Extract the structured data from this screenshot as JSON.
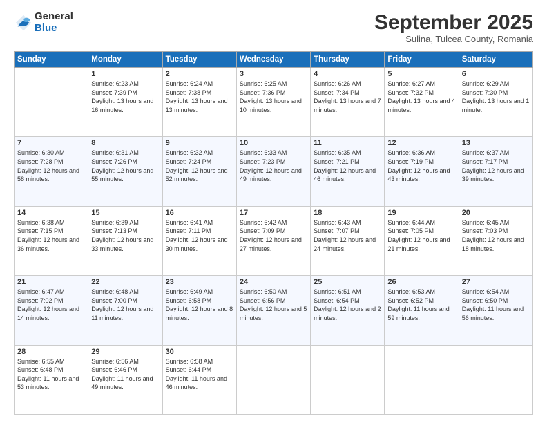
{
  "logo": {
    "general": "General",
    "blue": "Blue"
  },
  "header": {
    "month": "September 2025",
    "location": "Sulina, Tulcea County, Romania"
  },
  "weekdays": [
    "Sunday",
    "Monday",
    "Tuesday",
    "Wednesday",
    "Thursday",
    "Friday",
    "Saturday"
  ],
  "weeks": [
    [
      {
        "day": "",
        "sunrise": "",
        "sunset": "",
        "daylight": ""
      },
      {
        "day": "1",
        "sunrise": "Sunrise: 6:23 AM",
        "sunset": "Sunset: 7:39 PM",
        "daylight": "Daylight: 13 hours and 16 minutes."
      },
      {
        "day": "2",
        "sunrise": "Sunrise: 6:24 AM",
        "sunset": "Sunset: 7:38 PM",
        "daylight": "Daylight: 13 hours and 13 minutes."
      },
      {
        "day": "3",
        "sunrise": "Sunrise: 6:25 AM",
        "sunset": "Sunset: 7:36 PM",
        "daylight": "Daylight: 13 hours and 10 minutes."
      },
      {
        "day": "4",
        "sunrise": "Sunrise: 6:26 AM",
        "sunset": "Sunset: 7:34 PM",
        "daylight": "Daylight: 13 hours and 7 minutes."
      },
      {
        "day": "5",
        "sunrise": "Sunrise: 6:27 AM",
        "sunset": "Sunset: 7:32 PM",
        "daylight": "Daylight: 13 hours and 4 minutes."
      },
      {
        "day": "6",
        "sunrise": "Sunrise: 6:29 AM",
        "sunset": "Sunset: 7:30 PM",
        "daylight": "Daylight: 13 hours and 1 minute."
      }
    ],
    [
      {
        "day": "7",
        "sunrise": "Sunrise: 6:30 AM",
        "sunset": "Sunset: 7:28 PM",
        "daylight": "Daylight: 12 hours and 58 minutes."
      },
      {
        "day": "8",
        "sunrise": "Sunrise: 6:31 AM",
        "sunset": "Sunset: 7:26 PM",
        "daylight": "Daylight: 12 hours and 55 minutes."
      },
      {
        "day": "9",
        "sunrise": "Sunrise: 6:32 AM",
        "sunset": "Sunset: 7:24 PM",
        "daylight": "Daylight: 12 hours and 52 minutes."
      },
      {
        "day": "10",
        "sunrise": "Sunrise: 6:33 AM",
        "sunset": "Sunset: 7:23 PM",
        "daylight": "Daylight: 12 hours and 49 minutes."
      },
      {
        "day": "11",
        "sunrise": "Sunrise: 6:35 AM",
        "sunset": "Sunset: 7:21 PM",
        "daylight": "Daylight: 12 hours and 46 minutes."
      },
      {
        "day": "12",
        "sunrise": "Sunrise: 6:36 AM",
        "sunset": "Sunset: 7:19 PM",
        "daylight": "Daylight: 12 hours and 43 minutes."
      },
      {
        "day": "13",
        "sunrise": "Sunrise: 6:37 AM",
        "sunset": "Sunset: 7:17 PM",
        "daylight": "Daylight: 12 hours and 39 minutes."
      }
    ],
    [
      {
        "day": "14",
        "sunrise": "Sunrise: 6:38 AM",
        "sunset": "Sunset: 7:15 PM",
        "daylight": "Daylight: 12 hours and 36 minutes."
      },
      {
        "day": "15",
        "sunrise": "Sunrise: 6:39 AM",
        "sunset": "Sunset: 7:13 PM",
        "daylight": "Daylight: 12 hours and 33 minutes."
      },
      {
        "day": "16",
        "sunrise": "Sunrise: 6:41 AM",
        "sunset": "Sunset: 7:11 PM",
        "daylight": "Daylight: 12 hours and 30 minutes."
      },
      {
        "day": "17",
        "sunrise": "Sunrise: 6:42 AM",
        "sunset": "Sunset: 7:09 PM",
        "daylight": "Daylight: 12 hours and 27 minutes."
      },
      {
        "day": "18",
        "sunrise": "Sunrise: 6:43 AM",
        "sunset": "Sunset: 7:07 PM",
        "daylight": "Daylight: 12 hours and 24 minutes."
      },
      {
        "day": "19",
        "sunrise": "Sunrise: 6:44 AM",
        "sunset": "Sunset: 7:05 PM",
        "daylight": "Daylight: 12 hours and 21 minutes."
      },
      {
        "day": "20",
        "sunrise": "Sunrise: 6:45 AM",
        "sunset": "Sunset: 7:03 PM",
        "daylight": "Daylight: 12 hours and 18 minutes."
      }
    ],
    [
      {
        "day": "21",
        "sunrise": "Sunrise: 6:47 AM",
        "sunset": "Sunset: 7:02 PM",
        "daylight": "Daylight: 12 hours and 14 minutes."
      },
      {
        "day": "22",
        "sunrise": "Sunrise: 6:48 AM",
        "sunset": "Sunset: 7:00 PM",
        "daylight": "Daylight: 12 hours and 11 minutes."
      },
      {
        "day": "23",
        "sunrise": "Sunrise: 6:49 AM",
        "sunset": "Sunset: 6:58 PM",
        "daylight": "Daylight: 12 hours and 8 minutes."
      },
      {
        "day": "24",
        "sunrise": "Sunrise: 6:50 AM",
        "sunset": "Sunset: 6:56 PM",
        "daylight": "Daylight: 12 hours and 5 minutes."
      },
      {
        "day": "25",
        "sunrise": "Sunrise: 6:51 AM",
        "sunset": "Sunset: 6:54 PM",
        "daylight": "Daylight: 12 hours and 2 minutes."
      },
      {
        "day": "26",
        "sunrise": "Sunrise: 6:53 AM",
        "sunset": "Sunset: 6:52 PM",
        "daylight": "Daylight: 11 hours and 59 minutes."
      },
      {
        "day": "27",
        "sunrise": "Sunrise: 6:54 AM",
        "sunset": "Sunset: 6:50 PM",
        "daylight": "Daylight: 11 hours and 56 minutes."
      }
    ],
    [
      {
        "day": "28",
        "sunrise": "Sunrise: 6:55 AM",
        "sunset": "Sunset: 6:48 PM",
        "daylight": "Daylight: 11 hours and 53 minutes."
      },
      {
        "day": "29",
        "sunrise": "Sunrise: 6:56 AM",
        "sunset": "Sunset: 6:46 PM",
        "daylight": "Daylight: 11 hours and 49 minutes."
      },
      {
        "day": "30",
        "sunrise": "Sunrise: 6:58 AM",
        "sunset": "Sunset: 6:44 PM",
        "daylight": "Daylight: 11 hours and 46 minutes."
      },
      {
        "day": "",
        "sunrise": "",
        "sunset": "",
        "daylight": ""
      },
      {
        "day": "",
        "sunrise": "",
        "sunset": "",
        "daylight": ""
      },
      {
        "day": "",
        "sunrise": "",
        "sunset": "",
        "daylight": ""
      },
      {
        "day": "",
        "sunrise": "",
        "sunset": "",
        "daylight": ""
      }
    ]
  ]
}
